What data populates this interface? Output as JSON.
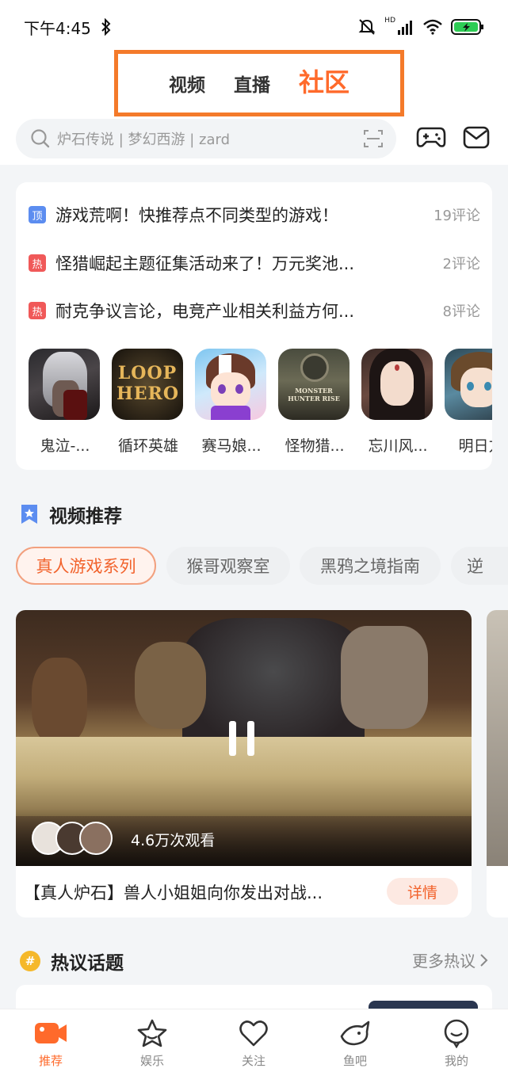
{
  "status_bar": {
    "time": "下午4:45",
    "network": "HD"
  },
  "header": {
    "tabs": [
      {
        "label": "视频"
      },
      {
        "label": "直播"
      },
      {
        "label": "社区"
      }
    ],
    "search_placeholder": "炉石传说 | 梦幻西游 | zard"
  },
  "hot_topics": [
    {
      "tag": "顶",
      "title": "游戏荒啊！快推荐点不同类型的游戏！",
      "count": "19评论"
    },
    {
      "tag": "热",
      "title": "怪猎崛起主题征集活动来了！万元奖池...",
      "count": "2评论"
    },
    {
      "tag": "热",
      "title": "耐克争议言论，电竞产业相关利益方何...",
      "count": "8评论"
    }
  ],
  "games": [
    {
      "label": "鬼泣-..."
    },
    {
      "label": "循环英雄",
      "logo_text": "LOOP HERO"
    },
    {
      "label": "赛马娘..."
    },
    {
      "label": "怪物猎...",
      "logo_text": "MONSTER HUNTER RISE"
    },
    {
      "label": "忘川风..."
    },
    {
      "label": "明日方"
    }
  ],
  "video_section": {
    "title": "视频推荐",
    "chips": [
      "真人游戏系列",
      "猴哥观察室",
      "黑鸦之境指南",
      "逆"
    ],
    "video": {
      "views": "4.6万次观看",
      "title": "【真人炉石】兽人小姐姐向你发出对战...",
      "detail_label": "详情"
    }
  },
  "discussion_section": {
    "title": "热议话题",
    "more_label": "更多热议"
  },
  "bottom_nav": [
    {
      "label": "推荐",
      "icon": "video-camera-icon"
    },
    {
      "label": "娱乐",
      "icon": "star-icon"
    },
    {
      "label": "关注",
      "icon": "heart-icon"
    },
    {
      "label": "鱼吧",
      "icon": "fish-icon"
    },
    {
      "label": "我的",
      "icon": "profile-icon"
    }
  ],
  "colors": {
    "accent": "#ff6a2b",
    "highlight_box": "#f47a2a",
    "tag_top": "#5c8df0",
    "tag_hot": "#f05959"
  }
}
